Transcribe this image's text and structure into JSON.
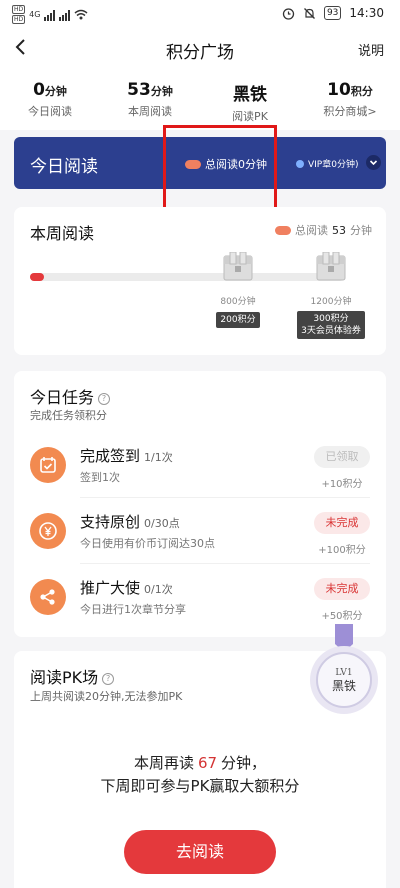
{
  "status_bar": {
    "sim_badges": [
      "HD",
      "HD"
    ],
    "network": "4G",
    "battery": "93",
    "time": "14:30"
  },
  "nav": {
    "title": "积分广场",
    "help": "说明"
  },
  "stats": [
    {
      "value": "0",
      "unit": "分钟",
      "label": "今日阅读"
    },
    {
      "value": "53",
      "unit": "分钟",
      "label": "本周阅读"
    },
    {
      "value": "黑铁",
      "unit": "",
      "label": "阅读PK"
    },
    {
      "value": "10",
      "unit": "积分",
      "label": "积分商城>"
    }
  ],
  "today_banner": {
    "title": "今日阅读",
    "total_label": "总阅读0分钟",
    "vip_label": "VIP章0分钟)"
  },
  "week_card": {
    "title": "本周阅读",
    "total_prefix": "总阅读",
    "total_value": "53",
    "total_unit": "分钟",
    "progress": 0.0442,
    "milestones": [
      {
        "minutes": "800分钟",
        "reward": "200积分",
        "reward_line2": ""
      },
      {
        "minutes": "1200分钟",
        "reward": "300积分",
        "reward_line2": "3天会员体验券"
      }
    ]
  },
  "tasks_card": {
    "title": "今日任务",
    "subtitle": "完成任务领积分",
    "tasks": [
      {
        "name": "完成签到",
        "count": "1/1次",
        "desc": "签到1次",
        "status": "已领取",
        "points": "+10积分",
        "icon": "calendar-icon"
      },
      {
        "name": "支持原创",
        "count": "0/30点",
        "desc": "今日使用有价币订阅达30点",
        "status": "未完成",
        "points": "+100积分",
        "icon": "yen-coin-icon"
      },
      {
        "name": "推广大使",
        "count": "0/1次",
        "desc": "今日进行1次章节分享",
        "status": "未完成",
        "points": "+50积分",
        "icon": "share-icon"
      }
    ]
  },
  "pk_card": {
    "title": "阅读PK场",
    "subtitle": "上周共阅读20分钟,无法参加PK",
    "msg_prefix": "本周再读",
    "msg_number": "67",
    "msg_suffix": "分钟，",
    "msg_line2": "下周即可参与PK赢取大额积分",
    "button": "去阅读",
    "medal_level": "LV1",
    "medal_name": "黑铁"
  },
  "colors": {
    "accent_red": "#e4393c",
    "banner_blue": "#2c3f8f",
    "task_orange": "#f28a50"
  }
}
